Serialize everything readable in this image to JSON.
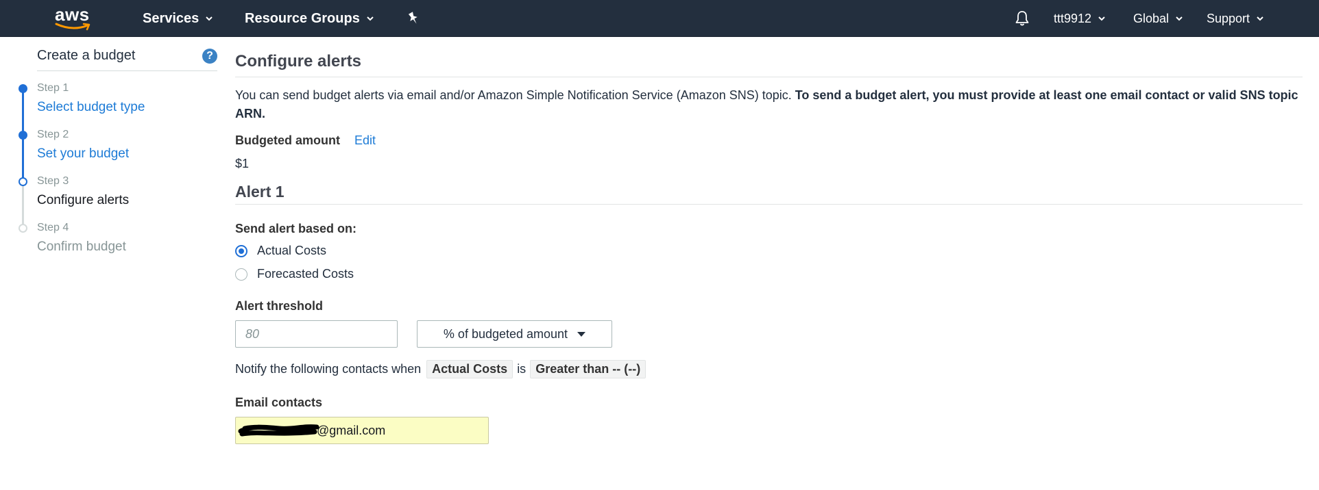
{
  "nav": {
    "logo": "aws",
    "services": "Services",
    "resource_groups": "Resource Groups",
    "user": "ttt9912",
    "region": "Global",
    "support": "Support"
  },
  "sidebar": {
    "title": "Create a budget",
    "help": "?",
    "steps": [
      {
        "number": "Step 1",
        "label": "Select budget type",
        "state": "complete"
      },
      {
        "number": "Step 2",
        "label": "Set your budget",
        "state": "complete"
      },
      {
        "number": "Step 3",
        "label": "Configure alerts",
        "state": "current"
      },
      {
        "number": "Step 4",
        "label": "Confirm budget",
        "state": "disabled"
      }
    ]
  },
  "main": {
    "heading": "Configure alerts",
    "intro_text": "You can send budget alerts via email and/or Amazon Simple Notification Service (Amazon SNS) topic. ",
    "intro_bold": "To send a budget alert, you must provide at least one email contact or valid SNS topic ARN.",
    "budgeted_amount_label": "Budgeted amount",
    "edit_link": "Edit",
    "budgeted_amount_value": "$1",
    "alert_heading": "Alert 1",
    "send_alert_label": "Send alert based on:",
    "radio_actual": "Actual Costs",
    "radio_forecasted": "Forecasted Costs",
    "threshold_label": "Alert threshold",
    "threshold_placeholder": "80",
    "threshold_unit": "% of budgeted amount",
    "notify_prefix": "Notify the following contacts when",
    "notify_chip1": "Actual Costs",
    "notify_is": "is",
    "notify_chip2": "Greater than -- (--)",
    "email_label": "Email contacts",
    "email_value": "@gmail.com"
  },
  "colors": {
    "nav_bg": "#232f3e",
    "accent": "#1f6fd6",
    "link": "#1d7bd6",
    "autofill_bg": "#fbfdc4"
  }
}
